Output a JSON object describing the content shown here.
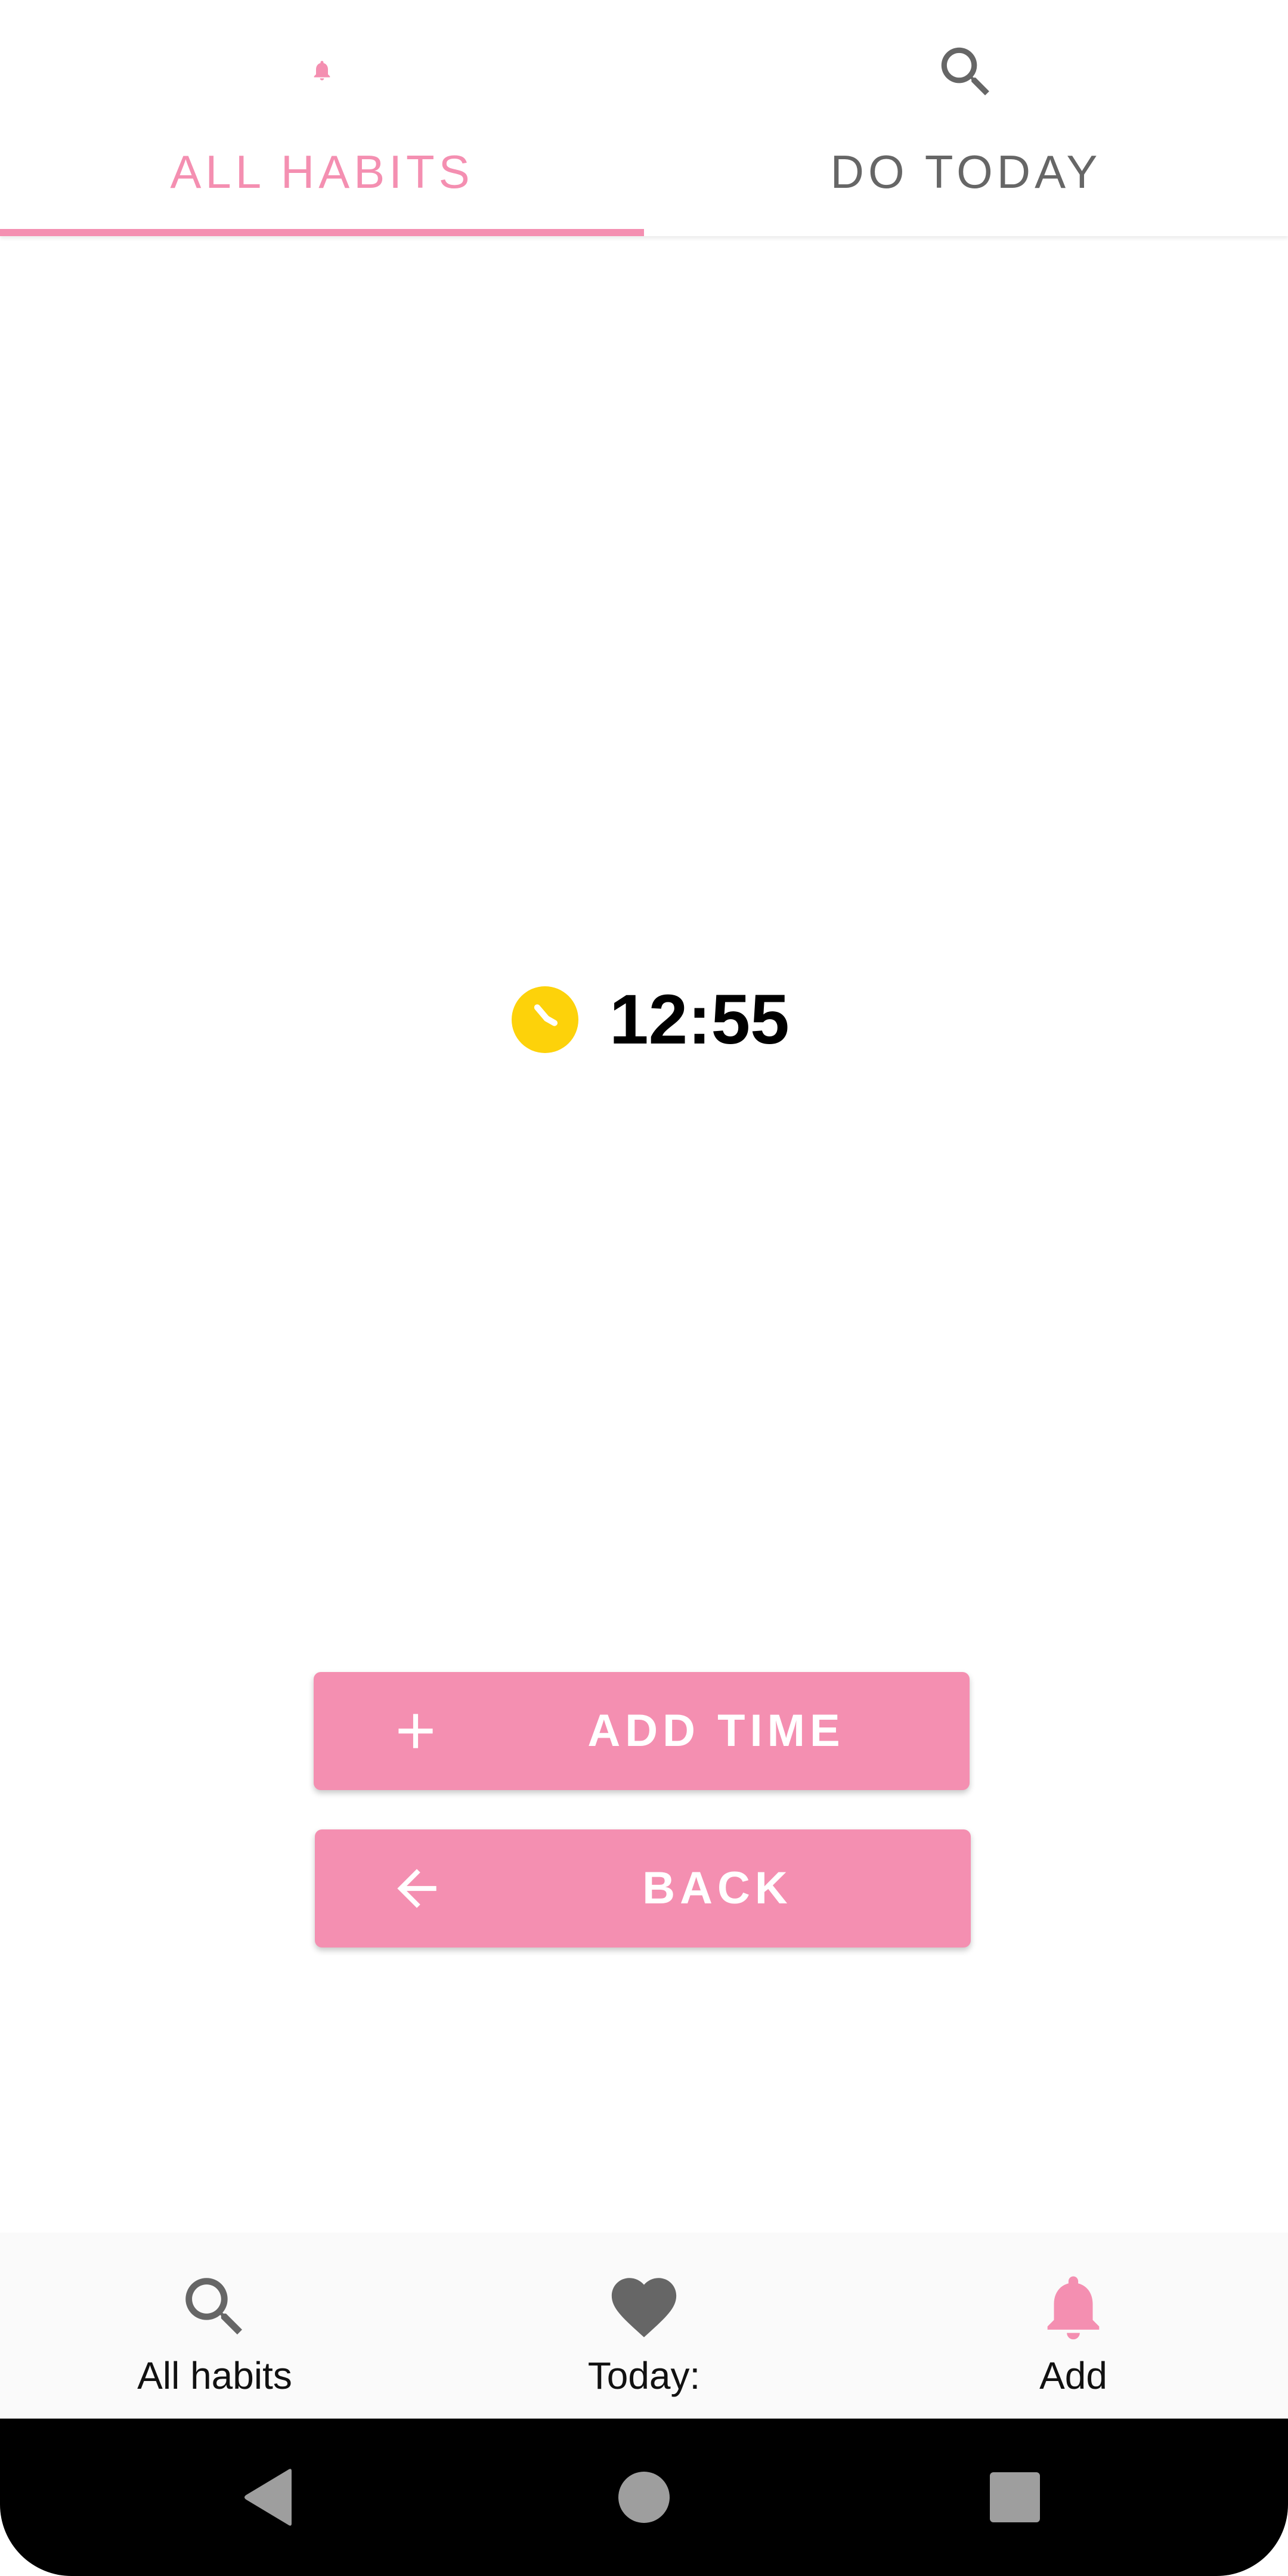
{
  "tabs": {
    "items": [
      {
        "label": "ALL HABITS",
        "icon": "bell-icon",
        "selected": true
      },
      {
        "label": "DO TODAY",
        "icon": "search-icon",
        "selected": false
      }
    ]
  },
  "timer": {
    "icon": "clock-icon",
    "time": "12:55"
  },
  "actions": {
    "add_time_label": "ADD TIME",
    "add_time_icon": "plus-icon",
    "back_label": "BACK",
    "back_icon": "arrow-left-icon"
  },
  "bottom_nav": {
    "items": [
      {
        "label": "All habits",
        "icon": "search-icon",
        "selected": false
      },
      {
        "label": "Today:",
        "icon": "heart-icon",
        "selected": false
      },
      {
        "label": "Add",
        "icon": "bell-icon",
        "selected": true
      }
    ]
  },
  "system_nav": {
    "buttons": [
      "back-triangle-icon",
      "home-circle-icon",
      "recents-square-icon"
    ]
  },
  "colors": {
    "accent": "#f48fb1",
    "clock": "#fdd20a",
    "inactive": "#666666",
    "system_bar": "#000000"
  }
}
